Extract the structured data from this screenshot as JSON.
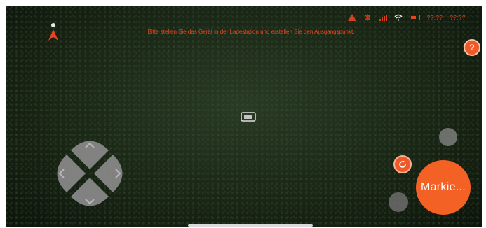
{
  "status_bar": {
    "icons": [
      "warning-icon",
      "bluetooth-icon",
      "signal-icon",
      "wifi-icon",
      "battery-icon"
    ],
    "text_1": "??:??",
    "text_2": "??:??"
  },
  "message": "Bitte stellen Sie das Gerät in der Ladestation und erstellen Sie den Ausgangspunkt.",
  "buttons": {
    "mark_label": "Markie..."
  },
  "colors": {
    "accent": "#f46124",
    "text_warning": "#e8451f",
    "dpad": "#8a8a8a"
  }
}
